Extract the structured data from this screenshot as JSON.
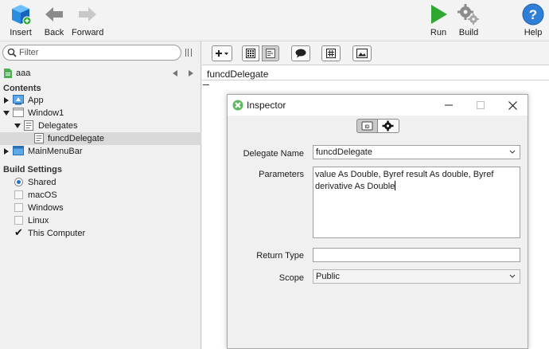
{
  "toolbar": {
    "insert": "Insert",
    "back": "Back",
    "forward": "Forward",
    "run": "Run",
    "build": "Build",
    "help": "Help"
  },
  "filter": {
    "placeholder": "Filter"
  },
  "project": {
    "name": "aaa"
  },
  "contents": {
    "header": "Contents",
    "items": [
      {
        "label": "App"
      },
      {
        "label": "Window1"
      },
      {
        "label": "Delegates"
      },
      {
        "label": "funcdDelegate"
      },
      {
        "label": "MainMenuBar"
      }
    ]
  },
  "build_settings": {
    "header": "Build Settings",
    "items": [
      {
        "label": "Shared"
      },
      {
        "label": "macOS"
      },
      {
        "label": "Windows"
      },
      {
        "label": "Linux"
      },
      {
        "label": "This Computer"
      }
    ]
  },
  "editor": {
    "tab_title": "funcdDelegate"
  },
  "inspector": {
    "title": "Inspector",
    "delegate_name_label": "Delegate Name",
    "delegate_name_value": "funcdDelegate",
    "parameters_label": "Parameters",
    "parameters_value": "value As Double, Byref result As double, Byref derivative As Double",
    "return_type_label": "Return Type",
    "return_type_value": "",
    "scope_label": "Scope",
    "scope_value": "Public"
  },
  "colors": {
    "accent": "#1e73c8",
    "run_green": "#2fa82f",
    "help_blue": "#2f7fd6",
    "insert_blue": "#2a8de0"
  }
}
